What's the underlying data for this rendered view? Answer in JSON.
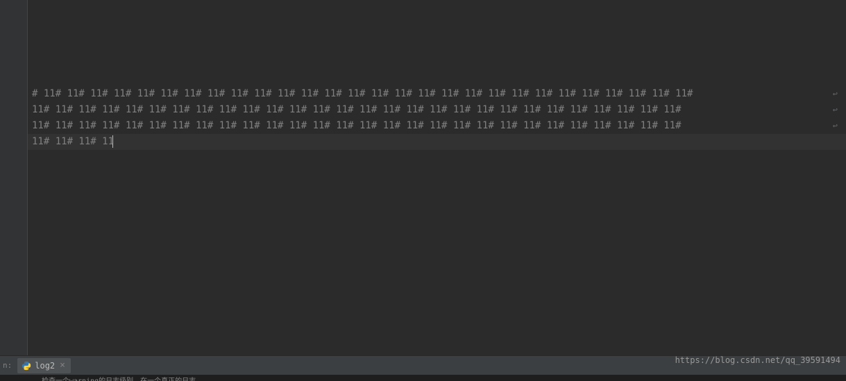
{
  "editor": {
    "lines": [
      "#  11#  11#  11#  11#  11#  11#  11#  11#  11#  11#  11#  11#  11#  11#  11#  11#  11#  11#  11#  11#  11#  11#  11#  11#  11#  11#  11#  11#  ",
      "11#  11#  11#  11#  11#  11#  11#  11#  11#  11#  11#  11#  11#  11#  11#  11#  11#  11#  11#  11#  11#  11#  11#  11#  11#  11#  11#  11#  ",
      "11#  11#  11#  11#  11#  11#  11#  11#  11#  11#  11#  11#  11#  11#  11#  11#  11#  11#  11#  11#  11#  11#  11#  11#  11#  11#  11#  11#  ",
      "11#  11#  11#  11"
    ],
    "wrap_glyph": "↩",
    "continuation_glyph": "↪"
  },
  "tabbar": {
    "prefix": "n:",
    "tab": {
      "name": "log2",
      "close": "×"
    }
  },
  "watermark": "https://blog.csdn.net/qq_39591494",
  "bottom": {
    "text": "检查一个warning的日志级别，在一个真正的日志"
  }
}
